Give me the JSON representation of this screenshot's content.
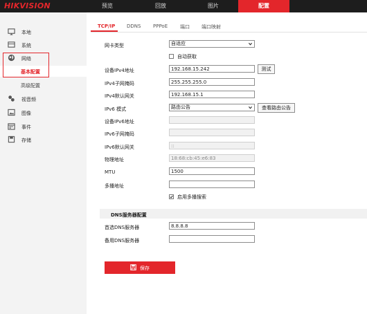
{
  "brand": {
    "logo": "HIKVISION",
    "accent": "#e3262b"
  },
  "topnav": [
    {
      "label": "预览",
      "active": false
    },
    {
      "label": "回放",
      "active": false
    },
    {
      "label": "图片",
      "active": false
    },
    {
      "label": "配置",
      "active": true
    }
  ],
  "sidebar": {
    "items": [
      {
        "label": "本地",
        "icon": "monitor-icon"
      },
      {
        "label": "系统",
        "icon": "system-icon"
      },
      {
        "label": "网络",
        "icon": "globe-icon"
      },
      {
        "label": "视音频",
        "icon": "video-audio-icon"
      },
      {
        "label": "图像",
        "icon": "image-icon"
      },
      {
        "label": "事件",
        "icon": "calendar-icon"
      },
      {
        "label": "存储",
        "icon": "storage-icon"
      }
    ],
    "network_sub": [
      {
        "label": "基本配置",
        "active": true
      },
      {
        "label": "高级配置",
        "active": false
      }
    ]
  },
  "tabs": [
    {
      "label": "TCP/IP",
      "active": true
    },
    {
      "label": "DDNS",
      "active": false
    },
    {
      "label": "PPPoE",
      "active": false
    },
    {
      "label": "端口",
      "active": false
    },
    {
      "label": "端口映射",
      "active": false
    }
  ],
  "form": {
    "nic_type": {
      "label": "网卡类型",
      "value": "自适应"
    },
    "dhcp": {
      "label": "自动获取",
      "checked": false
    },
    "ipv4_addr": {
      "label": "设备IPv4地址",
      "value": "192.168.15.242",
      "button": "测试"
    },
    "ipv4_mask": {
      "label": "IPv4子网掩码",
      "value": "255.255.255.0"
    },
    "ipv4_gw": {
      "label": "IPv4默认网关",
      "value": "192.168.15.1"
    },
    "ipv6_mode": {
      "label": "IPv6 模式",
      "value": "路由公告",
      "button": "查看路由公告"
    },
    "ipv6_addr": {
      "label": "设备IPv6地址",
      "value": ""
    },
    "ipv6_mask": {
      "label": "IPv6子网掩码",
      "value": ""
    },
    "ipv6_gw": {
      "label": "IPv6默认网关",
      "value": "::"
    },
    "mac": {
      "label": "物理地址",
      "value": "18:68:cb:45:e6:83"
    },
    "mtu": {
      "label": "MTU",
      "value": "1500"
    },
    "multicast": {
      "label": "多播地址",
      "value": ""
    },
    "multicast_search": {
      "label": "启用多播搜索",
      "checked": true
    }
  },
  "dns": {
    "title": "DNS服务器配置",
    "preferred": {
      "label": "首选DNS服务器",
      "value": "8.8.8.8"
    },
    "alternate": {
      "label": "备用DNS服务器",
      "value": ""
    }
  },
  "save": {
    "label": "保存"
  }
}
